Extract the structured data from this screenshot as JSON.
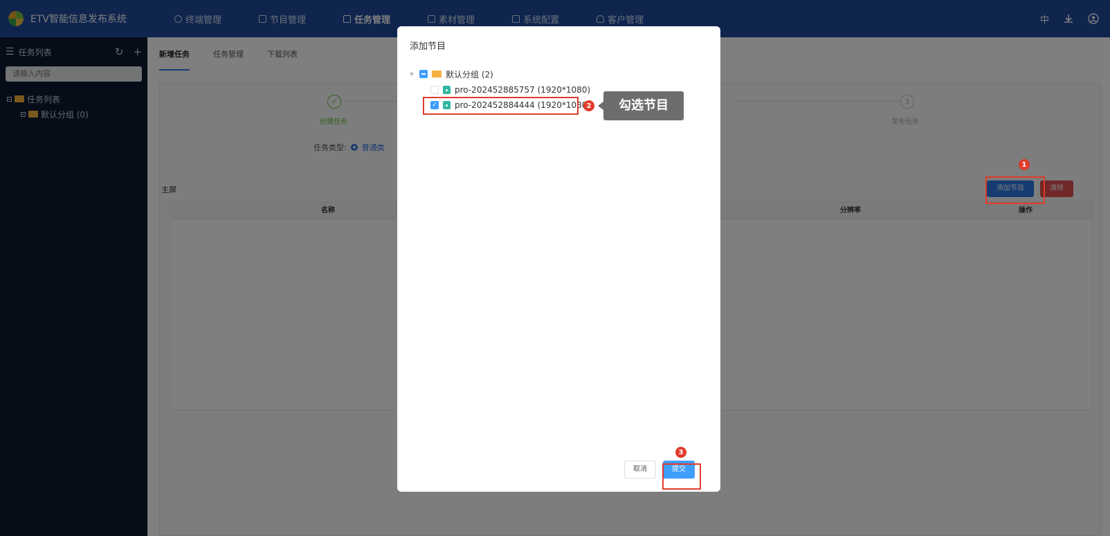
{
  "app": {
    "title": "ETV智能信息发布系统"
  },
  "nav": [
    {
      "label": "终端管理",
      "icon": "terminal-icon"
    },
    {
      "label": "节目管理",
      "icon": "program-icon"
    },
    {
      "label": "任务管理",
      "icon": "task-icon",
      "active": true
    },
    {
      "label": "素材管理",
      "icon": "material-icon"
    },
    {
      "label": "系统配置",
      "icon": "settings-icon"
    },
    {
      "label": "客户管理",
      "icon": "user-icon"
    }
  ],
  "top_right": {
    "lang": "中",
    "download_icon": "download-icon",
    "account_icon": "account-icon"
  },
  "sidebar": {
    "header": "任务列表",
    "search_placeholder": "请输入内容",
    "tree": [
      {
        "label": "任务列表",
        "level": 0
      },
      {
        "label": "默认分组 (0)",
        "level": 1
      }
    ]
  },
  "tabs": [
    {
      "label": "新增任务",
      "active": true
    },
    {
      "label": "任务管理"
    },
    {
      "label": "下载列表"
    }
  ],
  "steps": [
    {
      "label": "创建任务",
      "status": "done",
      "mark": "✓"
    },
    {
      "label": "发布任务",
      "status": "pending",
      "mark": "3"
    }
  ],
  "form": {
    "task_type_label": "任务类型:",
    "task_type_value": "普通类"
  },
  "screen": {
    "label": "主屏",
    "add_button": "添加节目",
    "clear_button": "清除",
    "columns": [
      "名称",
      "分辨率",
      "操作"
    ]
  },
  "modal": {
    "title": "添加节目",
    "group": {
      "label": "默认分组 (2)",
      "state": "indeterminate"
    },
    "items": [
      {
        "label": "pro-202452885757 (1920*1080)",
        "checked": false
      },
      {
        "label": "pro-202452884444 (1920*1080)",
        "checked": true
      }
    ],
    "cancel_button": "取消",
    "submit_button": "提交"
  },
  "annotations": {
    "badge1": "1",
    "badge2": "2",
    "badge3": "3",
    "tooltip": "勾选节目"
  },
  "colors": {
    "topbar": "#1f4a9c",
    "sidebar": "#0d1830",
    "primary": "#409eff",
    "danger": "#e05151",
    "annotation": "#e03b2b"
  }
}
